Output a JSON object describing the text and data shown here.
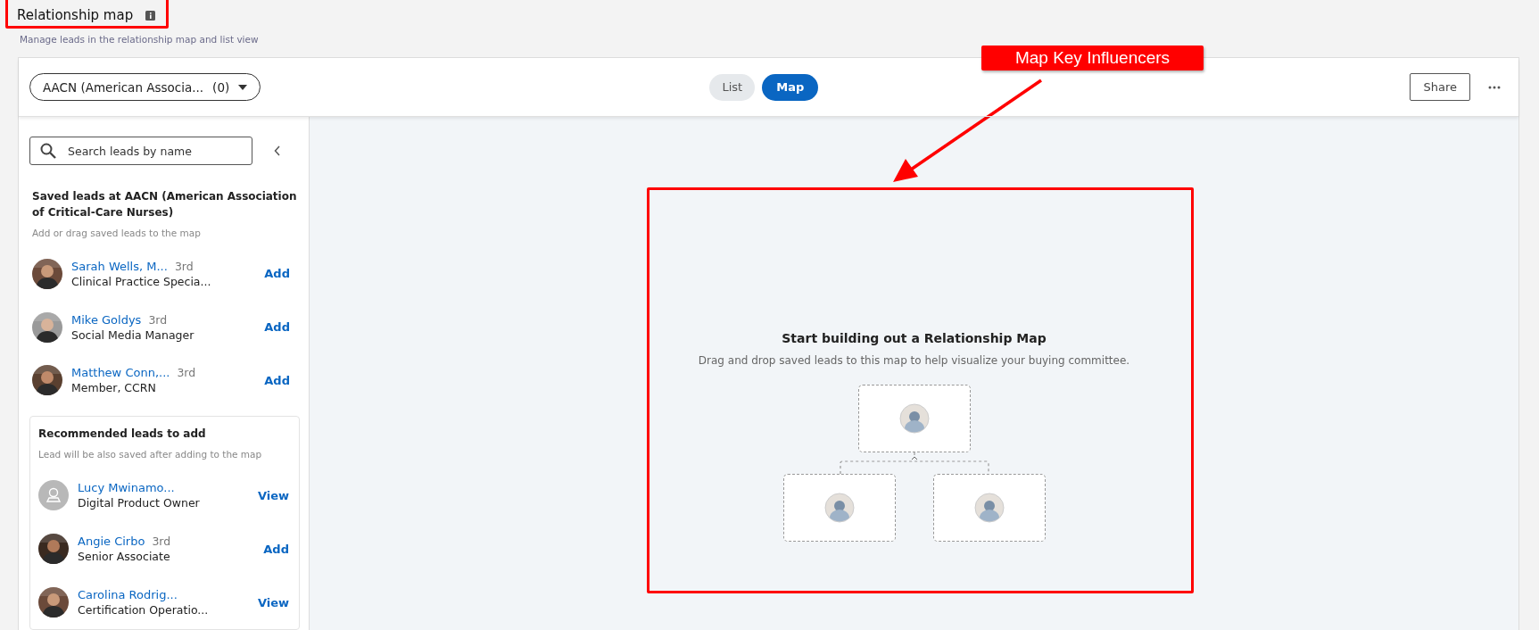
{
  "page": {
    "title": "Relationship map",
    "subtitle": "Manage leads in the relationship map and list view"
  },
  "toolbar": {
    "account": "AACN (American Associa...",
    "count": "(0)",
    "view_tabs": [
      {
        "label": "List",
        "selected": false
      },
      {
        "label": "Map",
        "selected": true
      }
    ],
    "share": "Share"
  },
  "sidebar": {
    "search": {
      "placeholder": "Search leads by name"
    },
    "saved_heading": "Saved leads at AACN (American Association of Critical-Care Nurses)",
    "saved_hint": "Add or drag saved leads to the map",
    "saved_leads": [
      {
        "name": "Sarah Wells, M...",
        "degree": "3rd",
        "title": "Clinical Practice Specia...",
        "action": "Add"
      },
      {
        "name": "Mike Goldys",
        "degree": "3rd",
        "title": "Social Media Manager",
        "action": "Add"
      },
      {
        "name": "Matthew Conn,...",
        "degree": "3rd",
        "title": "Member, CCRN",
        "action": "Add"
      }
    ],
    "recommended": {
      "heading": "Recommended leads to add",
      "hint": "Lead will be also saved after adding to the map",
      "leads": [
        {
          "name": "Lucy Mwinamo...",
          "title": "Digital Product Owner",
          "action": "View",
          "kind": "placeholder"
        },
        {
          "name": "Angie Cirbo",
          "degree": "3rd",
          "title": "Senior Associate",
          "action": "Add"
        },
        {
          "name": "Carolina Rodrig...",
          "title": "Certification Operatio...",
          "action": "View"
        }
      ]
    }
  },
  "map": {
    "empty_title": "Start building out a Relationship Map",
    "empty_text": "Drag and drop saved leads to this map to help visualize your buying committee."
  },
  "annotation": {
    "callout": "Map Key Influencers"
  }
}
